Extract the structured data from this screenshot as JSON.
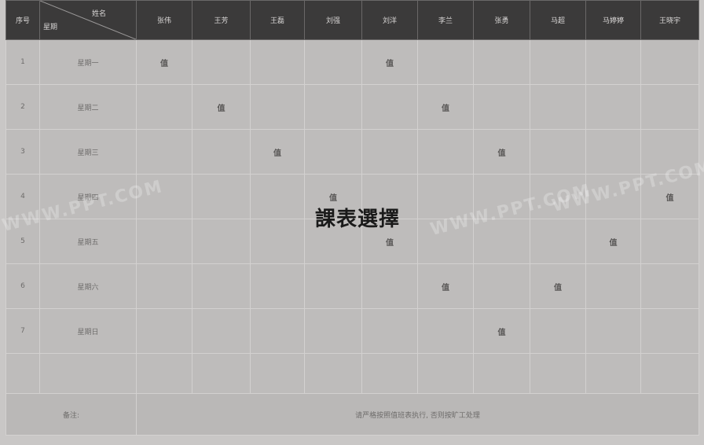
{
  "overlay": {
    "title": "課表選擇"
  },
  "header": {
    "index_label": "序号",
    "corner_top": "姓名",
    "corner_bottom": "星期",
    "names": [
      "张伟",
      "王芳",
      "王磊",
      "刘强",
      "刘洋",
      "李兰",
      "张勇",
      "马超",
      "马婷婷",
      "王晓宇"
    ]
  },
  "rows": [
    {
      "index": "1",
      "day": "星期一",
      "marks": [
        "值",
        "",
        "",
        "",
        "值",
        "",
        "",
        "",
        "",
        ""
      ]
    },
    {
      "index": "2",
      "day": "星期二",
      "marks": [
        "",
        "值",
        "",
        "",
        "",
        "值",
        "",
        "",
        "",
        ""
      ]
    },
    {
      "index": "3",
      "day": "星期三",
      "marks": [
        "",
        "",
        "值",
        "",
        "",
        "",
        "值",
        "",
        "",
        ""
      ]
    },
    {
      "index": "4",
      "day": "星期四",
      "marks": [
        "",
        "",
        "",
        "值",
        "",
        "",
        "",
        "",
        "",
        "值"
      ]
    },
    {
      "index": "5",
      "day": "星期五",
      "marks": [
        "",
        "",
        "",
        "",
        "值",
        "",
        "",
        "",
        "值",
        ""
      ]
    },
    {
      "index": "6",
      "day": "星期六",
      "marks": [
        "",
        "",
        "",
        "",
        "",
        "值",
        "",
        "值",
        "",
        ""
      ]
    },
    {
      "index": "7",
      "day": "星期日",
      "marks": [
        "",
        "",
        "",
        "",
        "",
        "",
        "值",
        "",
        "",
        ""
      ]
    }
  ],
  "remarks": {
    "label": "备注:",
    "text": "请严格按照值班表执行, 否则按旷工处理"
  },
  "watermarks": [
    "WWW.PPT.COM",
    "WWW.PPT.COM",
    "WWW.PPT.COM"
  ]
}
